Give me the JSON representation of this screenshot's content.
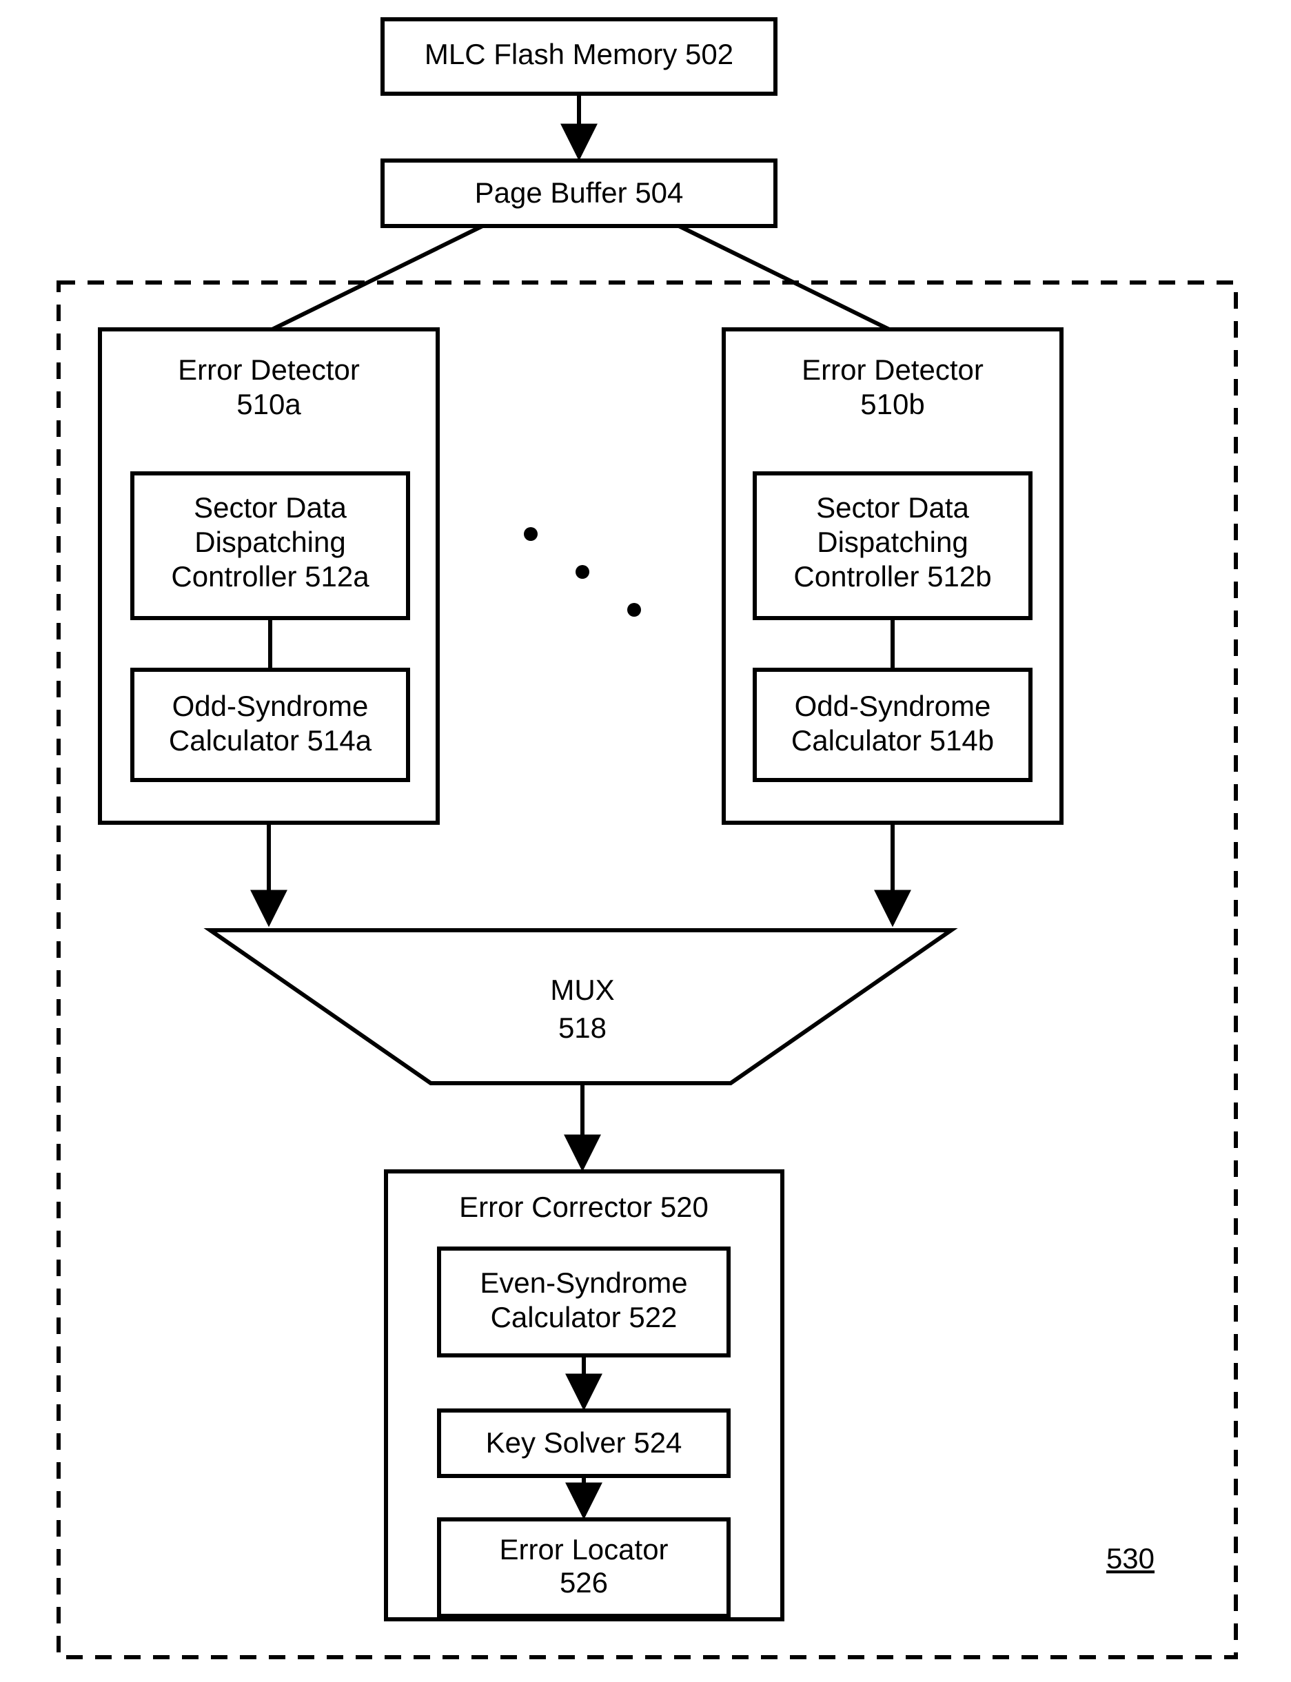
{
  "top": {
    "memory": "MLC Flash Memory 502",
    "buffer": "Page Buffer 504"
  },
  "detectors": [
    {
      "title_l1": "Error Detector",
      "title_l2": "510a",
      "dispatch_l1": "Sector Data",
      "dispatch_l2": "Dispatching",
      "dispatch_l3": "Controller 512a",
      "syndrome_l1": "Odd-Syndrome",
      "syndrome_l2": "Calculator 514a"
    },
    {
      "title_l1": "Error Detector",
      "title_l2": "510b",
      "dispatch_l1": "Sector Data",
      "dispatch_l2": "Dispatching",
      "dispatch_l3": "Controller 512b",
      "syndrome_l1": "Odd-Syndrome",
      "syndrome_l2": "Calculator 514b"
    }
  ],
  "mux": {
    "l1": "MUX",
    "l2": "518"
  },
  "corrector": {
    "title": "Error Corrector 520",
    "even_l1": "Even-Syndrome",
    "even_l2": "Calculator 522",
    "key": "Key Solver 524",
    "locator_l1": "Error Locator",
    "locator_l2": "526"
  },
  "module_ref": "530"
}
